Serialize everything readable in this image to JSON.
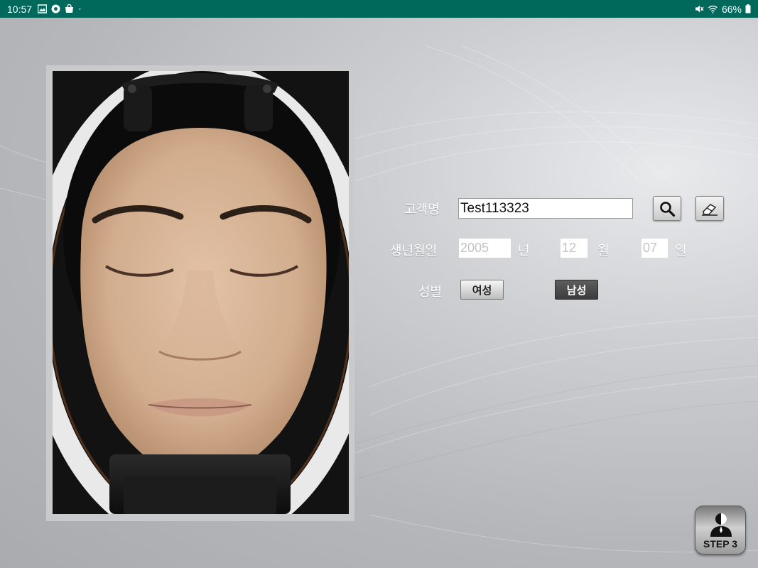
{
  "status_bar": {
    "time": "10:57",
    "battery": "66%",
    "icons": [
      "image-icon",
      "chrome-icon",
      "shopping-bag-icon",
      "dot-icon",
      "mute-icon",
      "wifi-icon",
      "battery-icon"
    ]
  },
  "form": {
    "customer_name_label": "고객명",
    "customer_name_value": "Test113323",
    "birthdate_label": "생년월일",
    "year_value": "2005",
    "year_unit": "년",
    "month_value": "12",
    "month_unit": "월",
    "day_value": "07",
    "day_unit": "일",
    "gender_label": "성별",
    "gender_female": "여성",
    "gender_male": "남성",
    "selected_gender": "남성"
  },
  "actions": {
    "search_icon": "search-icon",
    "clear_icon": "eraser-icon",
    "step_label": "STEP 3",
    "step_icon": "person-icon"
  },
  "colors": {
    "status_bar": "#00695c",
    "selected_gender_bg": "#4a4a4a"
  }
}
